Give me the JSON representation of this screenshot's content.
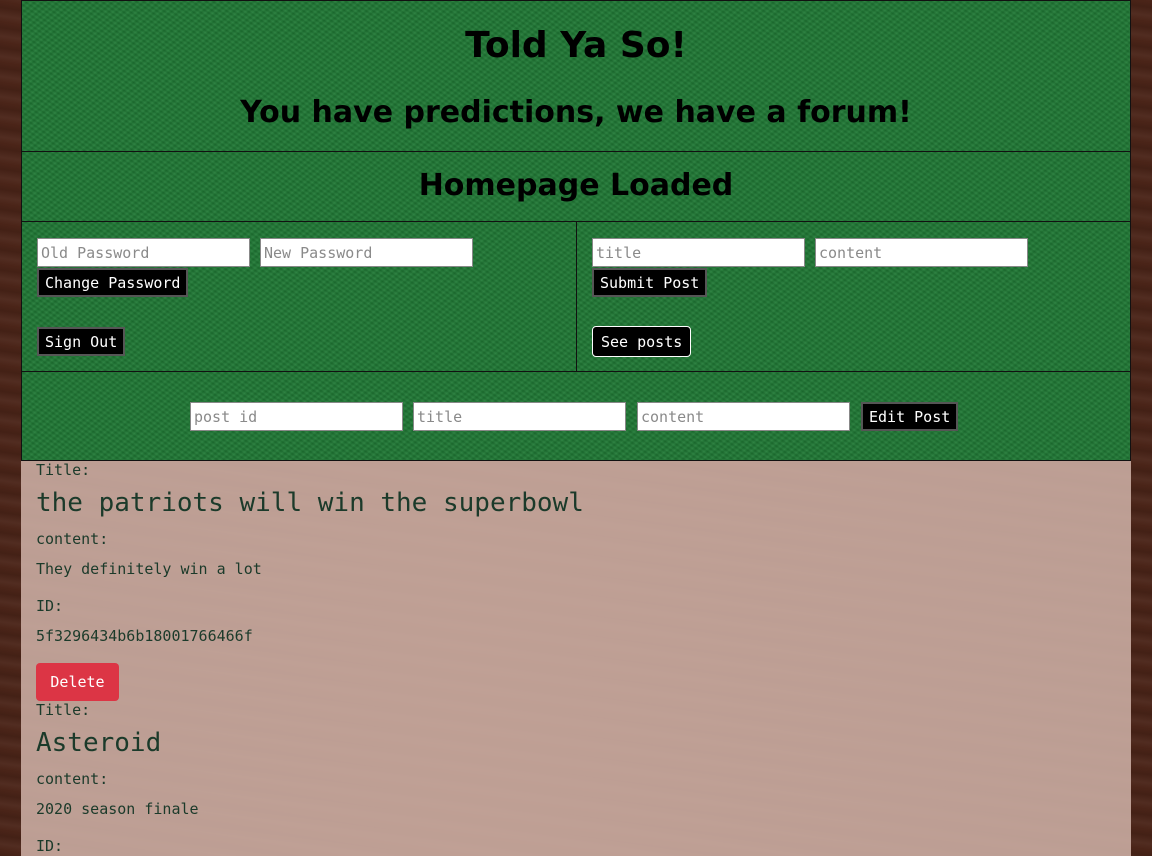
{
  "header": {
    "title": "Told Ya So!",
    "subtitle": "You have predictions, we have a forum!"
  },
  "status": {
    "message": "Homepage Loaded"
  },
  "account": {
    "old_password_placeholder": "Old Password",
    "new_password_placeholder": "New Password",
    "change_password_label": "Change Password",
    "sign_out_label": "Sign Out"
  },
  "new_post": {
    "title_placeholder": "title",
    "content_placeholder": "content",
    "submit_label": "Submit Post",
    "see_posts_label": "See posts"
  },
  "edit_post": {
    "post_id_placeholder": "post id",
    "title_placeholder": "title",
    "content_placeholder": "content",
    "edit_label": "Edit Post"
  },
  "posts": [
    {
      "title_label": "Title:",
      "title": "the patriots will win the superbowl",
      "content_label": "content:",
      "content": "They definitely win a lot",
      "id_label": "ID:",
      "id": "5f3296434b6b18001766466f",
      "delete_label": "Delete"
    },
    {
      "title_label": "Title:",
      "title": "Asteroid",
      "content_label": "content:",
      "content": "2020 season finale",
      "id_label": "ID:"
    }
  ]
}
